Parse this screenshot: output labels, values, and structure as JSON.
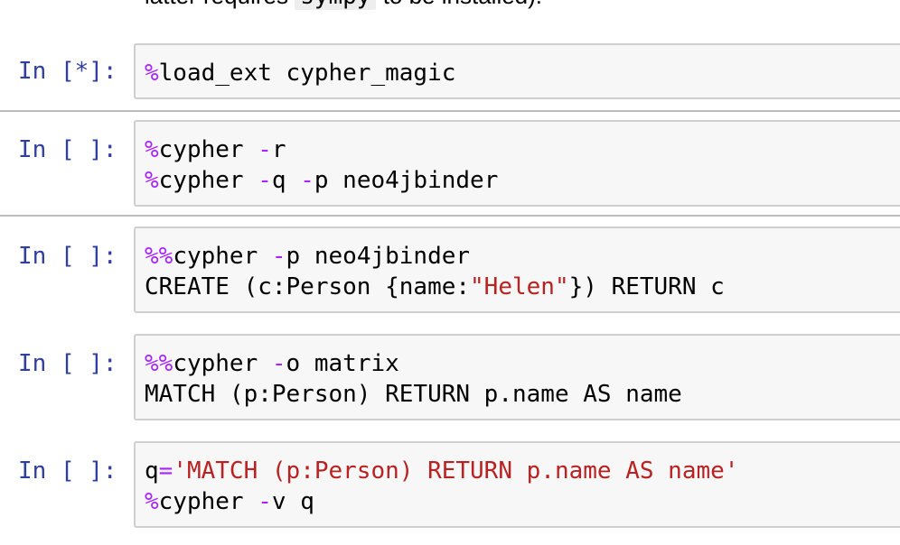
{
  "top_text": {
    "before": "latter requires ",
    "code": "sympy",
    "after": " to be installed)."
  },
  "cells": [
    {
      "prompt": "In [*]:",
      "lines": [
        {
          "magic": "%",
          "rest": "load_ext cypher_magic"
        }
      ]
    },
    {
      "prompt": "In [ ]:",
      "lines": [
        {
          "magic": "%",
          "cmd": "cypher ",
          "flag1": "-",
          "rest1": "r"
        },
        {
          "magic": "%",
          "cmd": "cypher ",
          "flag1": "-",
          "mid": "q ",
          "flag2": "-",
          "rest2": "p neo4jbinder"
        }
      ]
    },
    {
      "prompt": "In [ ]:",
      "lines": [
        {
          "magic": "%%",
          "cmd": "cypher ",
          "flag1": "-",
          "rest1": "p neo4jbinder"
        },
        {
          "pre": "CREATE (c:Person {name:",
          "str": "\"Helen\"",
          "post": "}) RETURN c"
        }
      ]
    },
    {
      "prompt": "In [ ]:",
      "lines": [
        {
          "magic": "%%",
          "cmd": "cypher ",
          "flag1": "-",
          "rest1": "o matrix"
        },
        {
          "pre": "MATCH (p:Person) RETURN p.name AS name"
        }
      ]
    },
    {
      "prompt": "In [ ]:",
      "lines": [
        {
          "var": "q",
          "op": "=",
          "str": "'MATCH (p:Person) RETURN p.name AS name'"
        },
        {
          "magic": "%",
          "cmd": "cypher ",
          "flag1": "-",
          "rest1": "v q"
        }
      ]
    }
  ]
}
